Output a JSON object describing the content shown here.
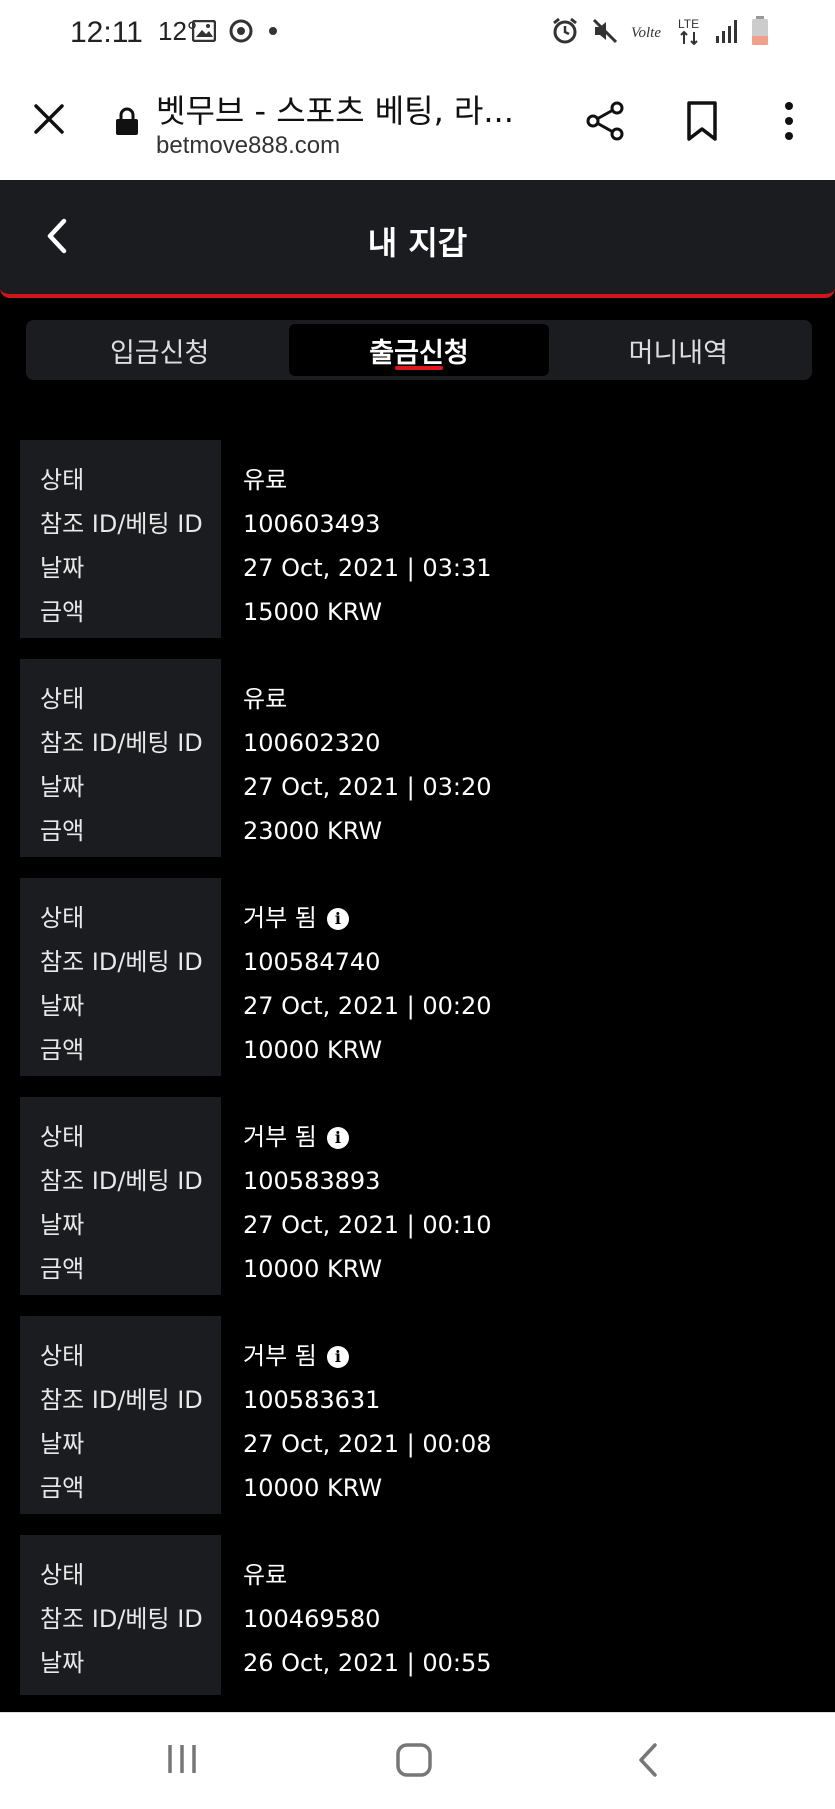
{
  "status_bar": {
    "time": "12:11",
    "temp": "12°",
    "icons_left": [
      "image-icon",
      "sync-icon",
      "dot-icon"
    ],
    "icons_right": [
      "alarm-icon",
      "mute-icon",
      "volte-icon",
      "lte-icon",
      "signal-icon",
      "battery-icon"
    ]
  },
  "browser": {
    "title": "벳무브 - 스포츠 베팅, 라...",
    "url": "betmove888.com"
  },
  "header": {
    "title": "내 지갑"
  },
  "tabs": [
    {
      "label": "입금신청",
      "active": false
    },
    {
      "label": "출금신청",
      "active": true
    },
    {
      "label": "머니내역",
      "active": false
    }
  ],
  "field_labels": {
    "status": "상태",
    "ref_id": "참조 ID/베팅 ID",
    "date": "날짜",
    "amount": "금액"
  },
  "records": [
    {
      "status": "유료",
      "ref_id": "100603493",
      "date": "27 Oct, 2021 | 03:31",
      "amount": "15000 KRW",
      "info": false
    },
    {
      "status": "유료",
      "ref_id": "100602320",
      "date": "27 Oct, 2021 | 03:20",
      "amount": "23000 KRW",
      "info": false
    },
    {
      "status": "거부 됨",
      "ref_id": "100584740",
      "date": "27 Oct, 2021 | 00:20",
      "amount": "10000 KRW",
      "info": true
    },
    {
      "status": "거부 됨",
      "ref_id": "100583893",
      "date": "27 Oct, 2021 | 00:10",
      "amount": "10000 KRW",
      "info": true
    },
    {
      "status": "거부 됨",
      "ref_id": "100583631",
      "date": "27 Oct, 2021 | 00:08",
      "amount": "10000 KRW",
      "info": true
    },
    {
      "status": "유료",
      "ref_id": "100469580",
      "date": "26 Oct, 2021 | 00:55",
      "amount": "",
      "info": false
    }
  ],
  "colors": {
    "accent": "#d0161b",
    "panel": "#1b1c20",
    "background": "#000000"
  }
}
